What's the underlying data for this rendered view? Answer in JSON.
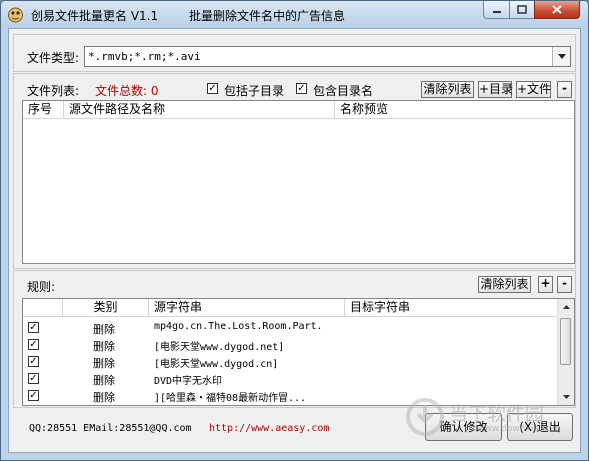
{
  "window": {
    "title": "创易文件批量更名 V1.1",
    "subtitle": "批量删除文件名中的广告信息",
    "controls": {
      "minimize": "minimize-icon",
      "maximize": "maximize-icon",
      "close": "close-icon"
    }
  },
  "file_type": {
    "label": "文件类型:",
    "value": "*.rmvb;*.rm;*.avi"
  },
  "file_list": {
    "label": "文件列表:",
    "total_label": "文件总数: 0",
    "include_subdirs": {
      "label": "包括子目录",
      "checked": true
    },
    "include_dirname": {
      "label": "包含目录名",
      "checked": true
    },
    "buttons": {
      "clear": "清除列表",
      "add_dir": "+目录",
      "add_file": "+文件",
      "remove": "-"
    },
    "columns": [
      "序号",
      "源文件路径及名称",
      "名称预览"
    ]
  },
  "rules": {
    "label": "规则:",
    "buttons": {
      "clear": "清除列表",
      "add": "+",
      "remove": "-"
    },
    "columns": [
      "",
      "类别",
      "源字符串",
      "目标字符串"
    ],
    "rows": [
      {
        "checked": true,
        "type": "删除",
        "source": "mp4go.cn.The.Lost.Room.Part.",
        "target": ""
      },
      {
        "checked": true,
        "type": "删除",
        "source": "[电影天堂www.dygod.net]",
        "target": ""
      },
      {
        "checked": true,
        "type": "删除",
        "source": "[电影天堂www.dygod.cn]",
        "target": ""
      },
      {
        "checked": true,
        "type": "删除",
        "source": "DVD中字无水印",
        "target": ""
      },
      {
        "checked": true,
        "type": "删除",
        "source": "][哈里森・福特08最新动作冒...",
        "target": ""
      }
    ]
  },
  "footer": {
    "contact": "QQ:28551 EMail:28551@QQ.com",
    "url": "http://www.aeasy.com",
    "confirm_button": "确认修改",
    "exit_button": "(X)退出"
  },
  "watermark": {
    "text": "当下软件园",
    "url": "www.downxia.com"
  }
}
